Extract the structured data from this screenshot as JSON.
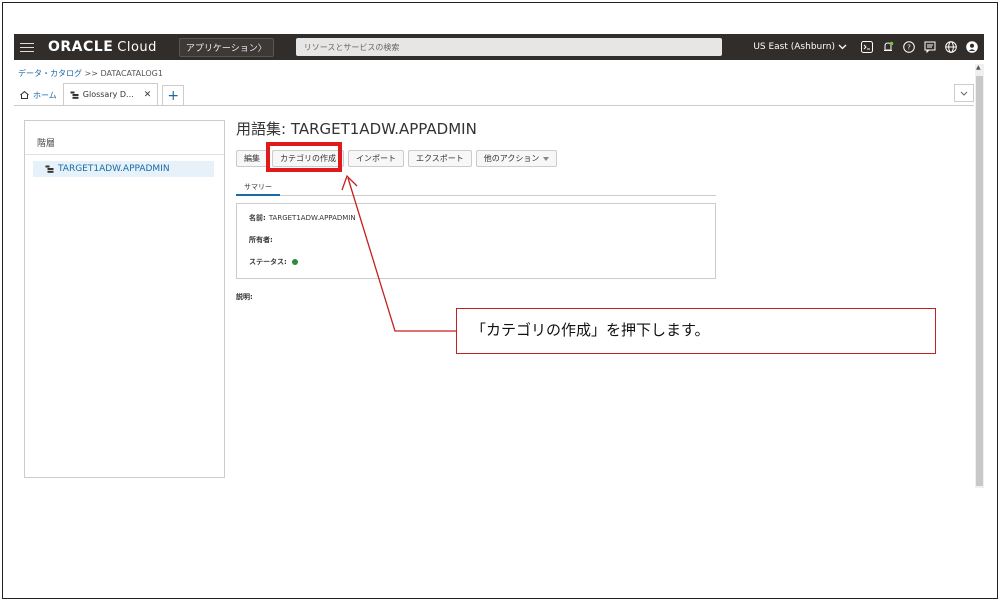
{
  "topbar": {
    "logo": "ORACLE",
    "logo_sub": "Cloud",
    "apps_button": "アプリケーション〉",
    "search_placeholder": "リソースとサービスの検索",
    "region": "US East (Ashburn)",
    "icons": [
      "terminal-icon",
      "bell-icon",
      "help-icon",
      "chat-icon",
      "globe-icon",
      "user-icon"
    ]
  },
  "breadcrumb": {
    "root": "データ・カタログ",
    "sep": ">>",
    "current": "DATACATALOG1"
  },
  "tabs": [
    {
      "label": "ホーム"
    },
    {
      "label": "Glossary D..."
    }
  ],
  "tabs_dropdown_icon": "chevron-down-icon",
  "left_panel": {
    "header": "階層",
    "tree_item": "TARGET1ADW.APPADMIN"
  },
  "main": {
    "title": "用語集: TARGET1ADW.APPADMIN",
    "actions": {
      "edit": "編集",
      "create_category": "カテゴリの作成",
      "import": "インポート",
      "export": "エクスポート",
      "other": "他のアクション"
    },
    "subtab": "サマリー",
    "summary": {
      "name_label": "名前:",
      "name_value": "TARGET1ADW.APPADMIN",
      "owner_label": "所有者:",
      "status_label": "ステータス:"
    },
    "description_label": "説明:"
  },
  "callout": {
    "text": "「カテゴリの作成」を押下します。",
    "border_color": "#c61f1f"
  },
  "colors": {
    "topbar": "#312d2a",
    "link": "#1a6aa7",
    "highlight": "#e01a1a",
    "status_active": "#2e8b3a"
  }
}
